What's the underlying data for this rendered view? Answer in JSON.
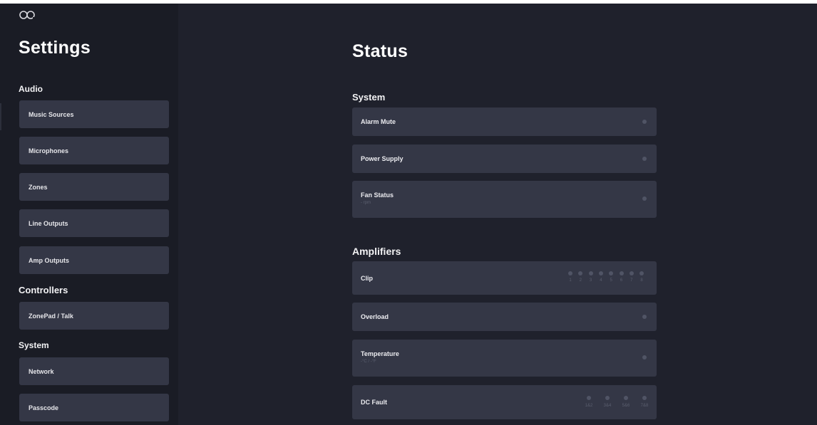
{
  "sidebar": {
    "title": "Settings",
    "sections": [
      {
        "label": "Audio",
        "items": [
          "Music Sources",
          "Microphones",
          "Zones",
          "Line Outputs",
          "Amp Outputs"
        ]
      },
      {
        "label": "Controllers",
        "items": [
          "ZonePad / Talk"
        ]
      },
      {
        "label": "System",
        "items": [
          "Network",
          "Passcode"
        ]
      }
    ]
  },
  "main": {
    "title": "Status",
    "groups": [
      {
        "label": "System",
        "rows": [
          {
            "label": "Alarm Mute"
          },
          {
            "label": "Power Supply"
          },
          {
            "label": "Fan Status",
            "sub": "- rpm"
          }
        ]
      },
      {
        "label": "Amplifiers",
        "rows": [
          {
            "label": "Clip",
            "channels": [
              "1",
              "2",
              "3",
              "4",
              "5",
              "6",
              "7",
              "8"
            ]
          },
          {
            "label": "Overload"
          },
          {
            "label": "Temperature",
            "sub": "-°C / -°F"
          },
          {
            "label": "DC Fault",
            "channels": [
              "1&2",
              "3&4",
              "5&6",
              "7&8"
            ]
          }
        ]
      }
    ]
  },
  "colors": {
    "background": "#1f212c",
    "sidebar": "#1a1c25",
    "row": "#343746",
    "indicator_off": "#505465"
  },
  "icons": {
    "logo": "infinity-logo-icon",
    "indicator": "status-dot-icon"
  }
}
